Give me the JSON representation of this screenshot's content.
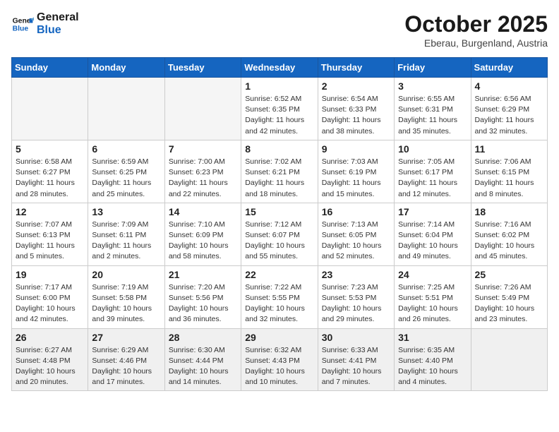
{
  "header": {
    "logo_line1": "General",
    "logo_line2": "Blue",
    "month_year": "October 2025",
    "location": "Eberau, Burgenland, Austria"
  },
  "weekdays": [
    "Sunday",
    "Monday",
    "Tuesday",
    "Wednesday",
    "Thursday",
    "Friday",
    "Saturday"
  ],
  "weeks": [
    [
      {
        "day": "",
        "info": ""
      },
      {
        "day": "",
        "info": ""
      },
      {
        "day": "",
        "info": ""
      },
      {
        "day": "1",
        "info": "Sunrise: 6:52 AM\nSunset: 6:35 PM\nDaylight: 11 hours\nand 42 minutes."
      },
      {
        "day": "2",
        "info": "Sunrise: 6:54 AM\nSunset: 6:33 PM\nDaylight: 11 hours\nand 38 minutes."
      },
      {
        "day": "3",
        "info": "Sunrise: 6:55 AM\nSunset: 6:31 PM\nDaylight: 11 hours\nand 35 minutes."
      },
      {
        "day": "4",
        "info": "Sunrise: 6:56 AM\nSunset: 6:29 PM\nDaylight: 11 hours\nand 32 minutes."
      }
    ],
    [
      {
        "day": "5",
        "info": "Sunrise: 6:58 AM\nSunset: 6:27 PM\nDaylight: 11 hours\nand 28 minutes."
      },
      {
        "day": "6",
        "info": "Sunrise: 6:59 AM\nSunset: 6:25 PM\nDaylight: 11 hours\nand 25 minutes."
      },
      {
        "day": "7",
        "info": "Sunrise: 7:00 AM\nSunset: 6:23 PM\nDaylight: 11 hours\nand 22 minutes."
      },
      {
        "day": "8",
        "info": "Sunrise: 7:02 AM\nSunset: 6:21 PM\nDaylight: 11 hours\nand 18 minutes."
      },
      {
        "day": "9",
        "info": "Sunrise: 7:03 AM\nSunset: 6:19 PM\nDaylight: 11 hours\nand 15 minutes."
      },
      {
        "day": "10",
        "info": "Sunrise: 7:05 AM\nSunset: 6:17 PM\nDaylight: 11 hours\nand 12 minutes."
      },
      {
        "day": "11",
        "info": "Sunrise: 7:06 AM\nSunset: 6:15 PM\nDaylight: 11 hours\nand 8 minutes."
      }
    ],
    [
      {
        "day": "12",
        "info": "Sunrise: 7:07 AM\nSunset: 6:13 PM\nDaylight: 11 hours\nand 5 minutes."
      },
      {
        "day": "13",
        "info": "Sunrise: 7:09 AM\nSunset: 6:11 PM\nDaylight: 11 hours\nand 2 minutes."
      },
      {
        "day": "14",
        "info": "Sunrise: 7:10 AM\nSunset: 6:09 PM\nDaylight: 10 hours\nand 58 minutes."
      },
      {
        "day": "15",
        "info": "Sunrise: 7:12 AM\nSunset: 6:07 PM\nDaylight: 10 hours\nand 55 minutes."
      },
      {
        "day": "16",
        "info": "Sunrise: 7:13 AM\nSunset: 6:05 PM\nDaylight: 10 hours\nand 52 minutes."
      },
      {
        "day": "17",
        "info": "Sunrise: 7:14 AM\nSunset: 6:04 PM\nDaylight: 10 hours\nand 49 minutes."
      },
      {
        "day": "18",
        "info": "Sunrise: 7:16 AM\nSunset: 6:02 PM\nDaylight: 10 hours\nand 45 minutes."
      }
    ],
    [
      {
        "day": "19",
        "info": "Sunrise: 7:17 AM\nSunset: 6:00 PM\nDaylight: 10 hours\nand 42 minutes."
      },
      {
        "day": "20",
        "info": "Sunrise: 7:19 AM\nSunset: 5:58 PM\nDaylight: 10 hours\nand 39 minutes."
      },
      {
        "day": "21",
        "info": "Sunrise: 7:20 AM\nSunset: 5:56 PM\nDaylight: 10 hours\nand 36 minutes."
      },
      {
        "day": "22",
        "info": "Sunrise: 7:22 AM\nSunset: 5:55 PM\nDaylight: 10 hours\nand 32 minutes."
      },
      {
        "day": "23",
        "info": "Sunrise: 7:23 AM\nSunset: 5:53 PM\nDaylight: 10 hours\nand 29 minutes."
      },
      {
        "day": "24",
        "info": "Sunrise: 7:25 AM\nSunset: 5:51 PM\nDaylight: 10 hours\nand 26 minutes."
      },
      {
        "day": "25",
        "info": "Sunrise: 7:26 AM\nSunset: 5:49 PM\nDaylight: 10 hours\nand 23 minutes."
      }
    ],
    [
      {
        "day": "26",
        "info": "Sunrise: 6:27 AM\nSunset: 4:48 PM\nDaylight: 10 hours\nand 20 minutes."
      },
      {
        "day": "27",
        "info": "Sunrise: 6:29 AM\nSunset: 4:46 PM\nDaylight: 10 hours\nand 17 minutes."
      },
      {
        "day": "28",
        "info": "Sunrise: 6:30 AM\nSunset: 4:44 PM\nDaylight: 10 hours\nand 14 minutes."
      },
      {
        "day": "29",
        "info": "Sunrise: 6:32 AM\nSunset: 4:43 PM\nDaylight: 10 hours\nand 10 minutes."
      },
      {
        "day": "30",
        "info": "Sunrise: 6:33 AM\nSunset: 4:41 PM\nDaylight: 10 hours\nand 7 minutes."
      },
      {
        "day": "31",
        "info": "Sunrise: 6:35 AM\nSunset: 4:40 PM\nDaylight: 10 hours\nand 4 minutes."
      },
      {
        "day": "",
        "info": ""
      }
    ]
  ]
}
